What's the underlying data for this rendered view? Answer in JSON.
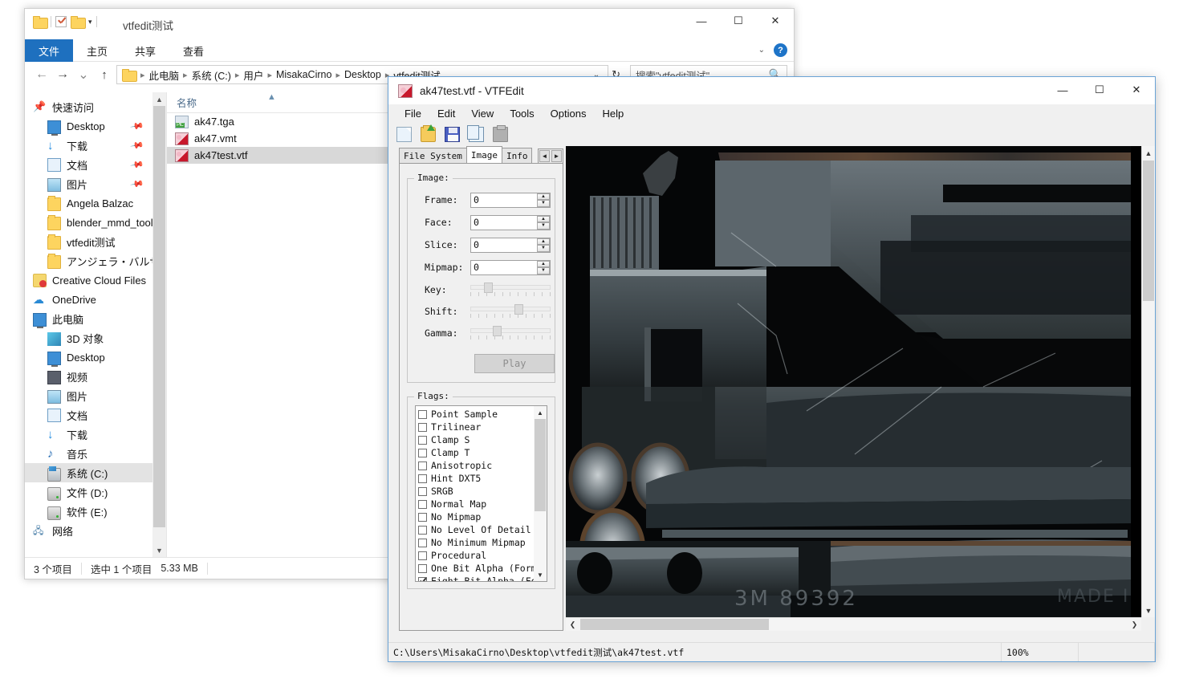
{
  "explorer": {
    "title": "vtfedit测试",
    "quick_access_icons": [
      "folder-icon",
      "properties-icon",
      "new-folder-icon",
      "customize-caret-icon"
    ],
    "ribbon_tabs": [
      {
        "label": "文件",
        "active": true
      },
      {
        "label": "主页",
        "active": false
      },
      {
        "label": "共享",
        "active": false
      },
      {
        "label": "查看",
        "active": false
      }
    ],
    "window_buttons": {
      "minimize": "—",
      "maximize": "☐",
      "close": "✕"
    },
    "ribbon_right": {
      "expand_caret": "⌄",
      "help": "?"
    },
    "nav": {
      "back": "←",
      "forward": "→",
      "recent": "⌄",
      "up": "↑"
    },
    "breadcrumbs": [
      "此电脑",
      "系统 (C:)",
      "用户",
      "MisakaCirno",
      "Desktop",
      "vtfedit测试"
    ],
    "address_caret": "⌄",
    "refresh": "↻",
    "search": {
      "placeholder": "搜索\"vtfedit测试\"",
      "icon": "search-icon"
    },
    "nav_pane": [
      {
        "label": "快速访问",
        "icon": "pin-star-icon",
        "indent": 1,
        "pinned": false
      },
      {
        "label": "Desktop",
        "icon": "desktop-icon",
        "indent": 2,
        "pinned": true
      },
      {
        "label": "下载",
        "icon": "downloads-icon",
        "indent": 2,
        "pinned": true
      },
      {
        "label": "文档",
        "icon": "documents-icon",
        "indent": 2,
        "pinned": true
      },
      {
        "label": "图片",
        "icon": "pictures-icon",
        "indent": 2,
        "pinned": true
      },
      {
        "label": "Angela Balzac",
        "icon": "folder-icon",
        "indent": 2,
        "pinned": false
      },
      {
        "label": "blender_mmd_tools-",
        "icon": "folder-icon",
        "indent": 2,
        "pinned": false
      },
      {
        "label": "vtfedit测试",
        "icon": "folder-icon",
        "indent": 2,
        "pinned": false
      },
      {
        "label": "アンジェラ・バルザッ",
        "icon": "folder-icon",
        "indent": 2,
        "pinned": false
      },
      {
        "label": "Creative Cloud Files",
        "icon": "creative-cloud-icon",
        "indent": 1,
        "pinned": false
      },
      {
        "label": "OneDrive",
        "icon": "onedrive-icon",
        "indent": 1,
        "pinned": false
      },
      {
        "label": "此电脑",
        "icon": "this-pc-icon",
        "indent": 1,
        "pinned": false
      },
      {
        "label": "3D 对象",
        "icon": "3d-objects-icon",
        "indent": 2,
        "pinned": false
      },
      {
        "label": "Desktop",
        "icon": "desktop-icon",
        "indent": 2,
        "pinned": false
      },
      {
        "label": "视频",
        "icon": "videos-icon",
        "indent": 2,
        "pinned": false
      },
      {
        "label": "图片",
        "icon": "pictures-icon",
        "indent": 2,
        "pinned": false
      },
      {
        "label": "文档",
        "icon": "documents-icon",
        "indent": 2,
        "pinned": false
      },
      {
        "label": "下载",
        "icon": "downloads-icon",
        "indent": 2,
        "pinned": false
      },
      {
        "label": "音乐",
        "icon": "music-icon",
        "indent": 2,
        "pinned": false
      },
      {
        "label": "系统 (C:)",
        "icon": "system-drive-icon",
        "indent": 2,
        "pinned": false,
        "selected": true
      },
      {
        "label": "文件 (D:)",
        "icon": "drive-icon",
        "indent": 2,
        "pinned": false
      },
      {
        "label": "软件 (E:)",
        "icon": "drive-icon",
        "indent": 2,
        "pinned": false
      },
      {
        "label": "网络",
        "icon": "network-icon",
        "indent": 1,
        "pinned": false
      }
    ],
    "column_header": "名称",
    "files": [
      {
        "name": "ak47.tga",
        "icon": "tga-file-icon",
        "selected": false
      },
      {
        "name": "ak47.vmt",
        "icon": "vtf-file-icon",
        "selected": false
      },
      {
        "name": "ak47test.vtf",
        "icon": "vtf-file-icon",
        "selected": true
      }
    ],
    "status": [
      "3 个项目",
      "选中 1 个项目",
      "5.33 MB"
    ]
  },
  "vtfedit": {
    "title": "ak47test.vtf - VTFEdit",
    "window_buttons": {
      "minimize": "—",
      "maximize": "☐",
      "close": "✕"
    },
    "menu": [
      "File",
      "Edit",
      "View",
      "Tools",
      "Options",
      "Help"
    ],
    "toolbar": [
      {
        "name": "new-file-icon"
      },
      {
        "name": "open-file-icon"
      },
      {
        "name": "save-file-icon"
      },
      {
        "name": "copy-icon"
      },
      {
        "name": "paste-icon"
      }
    ],
    "tabs": [
      {
        "label": "File System",
        "active": false
      },
      {
        "label": "Image",
        "active": true
      },
      {
        "label": "Info",
        "active": false
      }
    ],
    "tab_nav": {
      "prev": "◄",
      "next": "►"
    },
    "image_group": {
      "legend": "Image:",
      "spinners": [
        {
          "label": "Frame:",
          "value": "0"
        },
        {
          "label": "Face:",
          "value": "0"
        },
        {
          "label": "Slice:",
          "value": "0"
        },
        {
          "label": "Mipmap:",
          "value": "0"
        }
      ],
      "sliders": [
        {
          "label": "Key:",
          "percent": 19
        },
        {
          "label": "Shift:",
          "percent": 62
        },
        {
          "label": "Gamma:",
          "percent": 31
        }
      ],
      "play_button": "Play"
    },
    "flags_group": {
      "legend": "Flags:",
      "items": [
        {
          "label": "Point Sample",
          "checked": false
        },
        {
          "label": "Trilinear",
          "checked": false
        },
        {
          "label": "Clamp S",
          "checked": false
        },
        {
          "label": "Clamp T",
          "checked": false
        },
        {
          "label": "Anisotropic",
          "checked": false
        },
        {
          "label": "Hint DXT5",
          "checked": false
        },
        {
          "label": "SRGB",
          "checked": false
        },
        {
          "label": "Normal Map",
          "checked": false
        },
        {
          "label": "No Mipmap",
          "checked": false
        },
        {
          "label": "No Level Of Detail",
          "checked": false
        },
        {
          "label": "No Minimum Mipmap",
          "checked": false
        },
        {
          "label": "Procedural",
          "checked": false
        },
        {
          "label": "One Bit Alpha (Format",
          "checked": false
        },
        {
          "label": "Eight Bit Alpha (Form",
          "checked": true
        }
      ]
    },
    "preview": {
      "texture_labels": [
        "3M  89392",
        "MADE IN"
      ],
      "scroll_up": "▲",
      "scroll_down": "▼",
      "scroll_left": "❮",
      "scroll_right": "❯"
    },
    "status": {
      "path": "C:\\Users\\MisakaCirno\\Desktop\\vtfedit测试\\ak47test.vtf",
      "zoom": "100%",
      "extra": ""
    }
  },
  "colors": {
    "accent": "#1e70bf",
    "selection": "#cfe8f7",
    "vtf_border": "#6aa3d6",
    "texture_dark": "#0a0c0d",
    "texture_metal": "#4b5459"
  }
}
